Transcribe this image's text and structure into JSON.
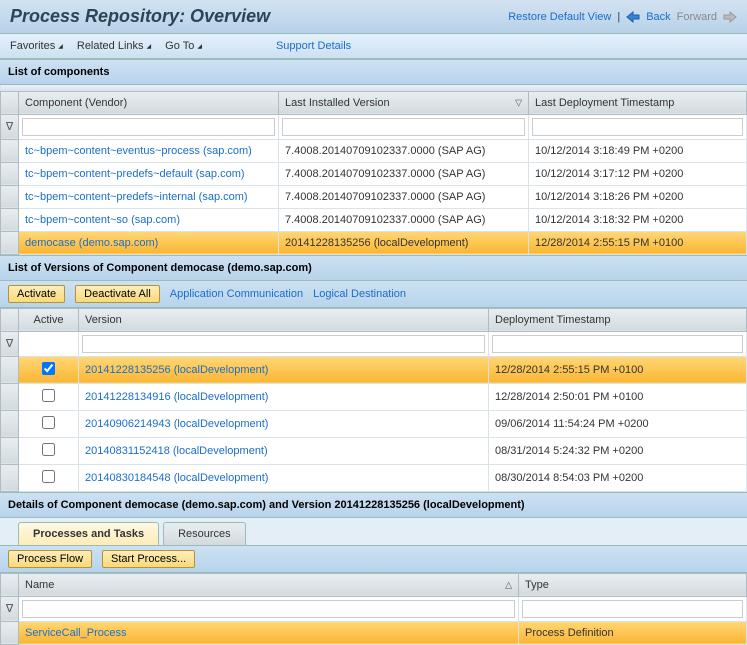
{
  "header": {
    "title": "Process Repository: Overview",
    "restore": "Restore Default View",
    "back": "Back",
    "forward": "Forward"
  },
  "menubar": {
    "favorites": "Favorites",
    "related": "Related Links",
    "goto": "Go To",
    "support": "Support Details"
  },
  "components": {
    "title": "List of components",
    "col_component": "Component (Vendor)",
    "col_version": "Last Installed Version",
    "col_timestamp": "Last Deployment Timestamp",
    "rows": [
      {
        "comp": "tc~bpem~content~eventus~process (sap.com)",
        "ver": "7.4008.20140709102337.0000 (SAP AG)",
        "ts": "10/12/2014 3:18:49 PM +0200"
      },
      {
        "comp": "tc~bpem~content~predefs~default (sap.com)",
        "ver": "7.4008.20140709102337.0000 (SAP AG)",
        "ts": "10/12/2014 3:17:12 PM +0200"
      },
      {
        "comp": "tc~bpem~content~predefs~internal (sap.com)",
        "ver": "7.4008.20140709102337.0000 (SAP AG)",
        "ts": "10/12/2014 3:18:26 PM +0200"
      },
      {
        "comp": "tc~bpem~content~so (sap.com)",
        "ver": "7.4008.20140709102337.0000 (SAP AG)",
        "ts": "10/12/2014 3:18:32 PM +0200"
      },
      {
        "comp": "democase (demo.sap.com)",
        "ver": "20141228135256 (localDevelopment)",
        "ts": "12/28/2014 2:55:15 PM +0100",
        "selected": true
      }
    ]
  },
  "versions": {
    "title": "List of Versions of Component democase (demo.sap.com)",
    "btn_activate": "Activate",
    "btn_deactivate": "Deactivate All",
    "link_appcomm": "Application Communication",
    "link_logical": "Logical Destination",
    "col_active": "Active",
    "col_version": "Version",
    "col_timestamp": "Deployment Timestamp",
    "rows": [
      {
        "active": true,
        "ver": "20141228135256 (localDevelopment)",
        "ts": "12/28/2014 2:55:15 PM +0100",
        "selected": true
      },
      {
        "active": false,
        "ver": "20141228134916 (localDevelopment)",
        "ts": "12/28/2014 2:50:01 PM +0100"
      },
      {
        "active": false,
        "ver": "20140906214943 (localDevelopment)",
        "ts": "09/06/2014 11:54:24 PM +0200"
      },
      {
        "active": false,
        "ver": "20140831152418 (localDevelopment)",
        "ts": "08/31/2014 5:24:32 PM +0200"
      },
      {
        "active": false,
        "ver": "20140830184548 (localDevelopment)",
        "ts": "08/30/2014 8:54:03 PM +0200"
      }
    ]
  },
  "details": {
    "title": "Details of Component democase (demo.sap.com) and Version 20141228135256 (localDevelopment)",
    "tab_processes": "Processes and Tasks",
    "tab_resources": "Resources",
    "btn_flow": "Process Flow",
    "btn_start": "Start Process...",
    "col_name": "Name",
    "col_type": "Type",
    "rows": [
      {
        "name": "ServiceCall_Process",
        "type": "Process Definition",
        "selected": true
      }
    ]
  }
}
